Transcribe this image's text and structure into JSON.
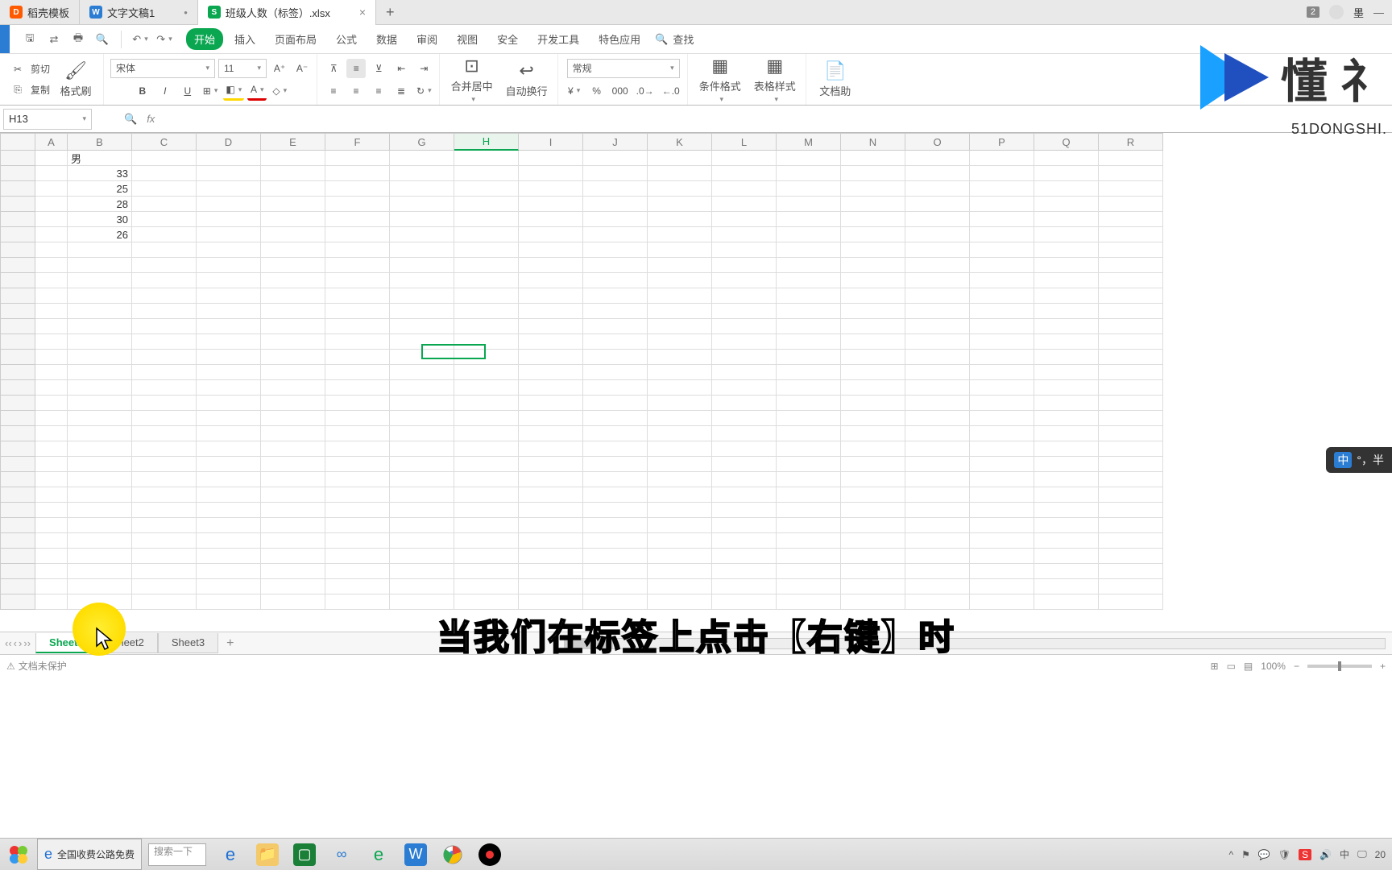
{
  "tabs": {
    "templates": "稻壳模板",
    "doc": "文字文稿1",
    "sheet": "班级人数（标签）.xlsx"
  },
  "window": {
    "badge": "2",
    "user": "墨"
  },
  "qat": {
    "undo": "↶",
    "redo": "↷"
  },
  "menu": {
    "start": "开始",
    "insert": "插入",
    "page": "页面布局",
    "formula": "公式",
    "data": "数据",
    "review": "审阅",
    "view": "视图",
    "safety": "安全",
    "dev": "开发工具",
    "special": "特色应用",
    "search": "查找"
  },
  "toolbar": {
    "cut": "剪切",
    "copy": "复制",
    "paste_icon": "📋",
    "format_painter": "格式刷",
    "font_name": "宋体",
    "font_size": "11",
    "bold": "B",
    "italic": "I",
    "underline": "U",
    "merge": "合并居中",
    "wrap": "自动换行",
    "number_format": "常规",
    "cond_format": "条件格式",
    "table_style": "表格样式",
    "doc_assist": "文档助"
  },
  "namebox": "H13",
  "columns": [
    "A",
    "B",
    "C",
    "D",
    "E",
    "F",
    "G",
    "H",
    "I",
    "J",
    "K",
    "L",
    "M",
    "N",
    "O",
    "P",
    "Q",
    "R"
  ],
  "cells": {
    "b1": "男",
    "b2": "33",
    "b3": "25",
    "b4": "28",
    "b5": "30",
    "b6": "26"
  },
  "sheets": {
    "s1": "Sheet1",
    "s2": "Sheet2",
    "s3": "Sheet3"
  },
  "status": {
    "protect": "文档未保护",
    "zoom": "100%"
  },
  "ime": {
    "mode": "中",
    "punct": "°，半"
  },
  "subtitle": "当我们在标签上点击【右键】时",
  "watermark": {
    "brand": "懂 礻",
    "url": "51DONGSHI."
  },
  "taskbar": {
    "ie_title": "全国收费公路免费",
    "search": "搜索一下",
    "lang": "中",
    "time": "20"
  }
}
